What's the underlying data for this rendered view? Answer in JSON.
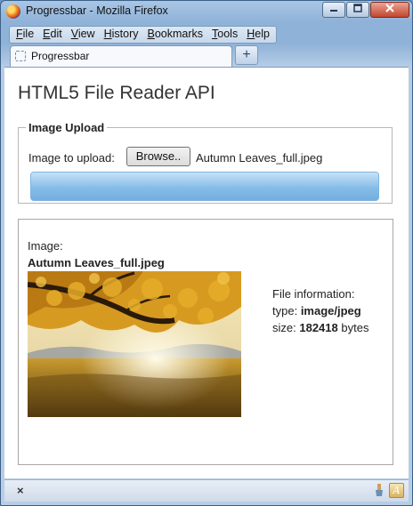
{
  "window": {
    "title": "Progressbar - Mozilla Firefox",
    "controls": [
      "minimize",
      "maximize",
      "close"
    ]
  },
  "menubar": {
    "items": [
      {
        "label": "File",
        "underline": "F"
      },
      {
        "label": "Edit",
        "underline": "E"
      },
      {
        "label": "View",
        "underline": "V"
      },
      {
        "label": "History",
        "underline": "H"
      },
      {
        "label": "Bookmarks",
        "underline": "B"
      },
      {
        "label": "Tools",
        "underline": "T"
      },
      {
        "label": "Help",
        "underline": "H"
      }
    ]
  },
  "tabs": {
    "active_label": "Progressbar",
    "new_tab_symbol": "+"
  },
  "page": {
    "heading": "HTML5 File Reader API",
    "upload": {
      "legend": "Image Upload",
      "label": "Image to upload:",
      "browse_label": "Browse..",
      "file_name": "Autumn Leaves_full.jpeg",
      "progress_fraction": 1.0
    },
    "preview": {
      "image_label": "Image:",
      "image_name": "Autumn Leaves_full.jpeg",
      "info_heading": "File information:",
      "type_label": "type:",
      "type_value": "image/jpeg",
      "size_label": "size:",
      "size_value": "182418",
      "size_unit": "bytes"
    }
  },
  "statusbar": {
    "close_symbol": "×",
    "icons": [
      "paint-brush-icon",
      "acrobat-icon"
    ]
  },
  "colors": {
    "progress": "#86bde8",
    "frame": "#8fb2d8"
  }
}
